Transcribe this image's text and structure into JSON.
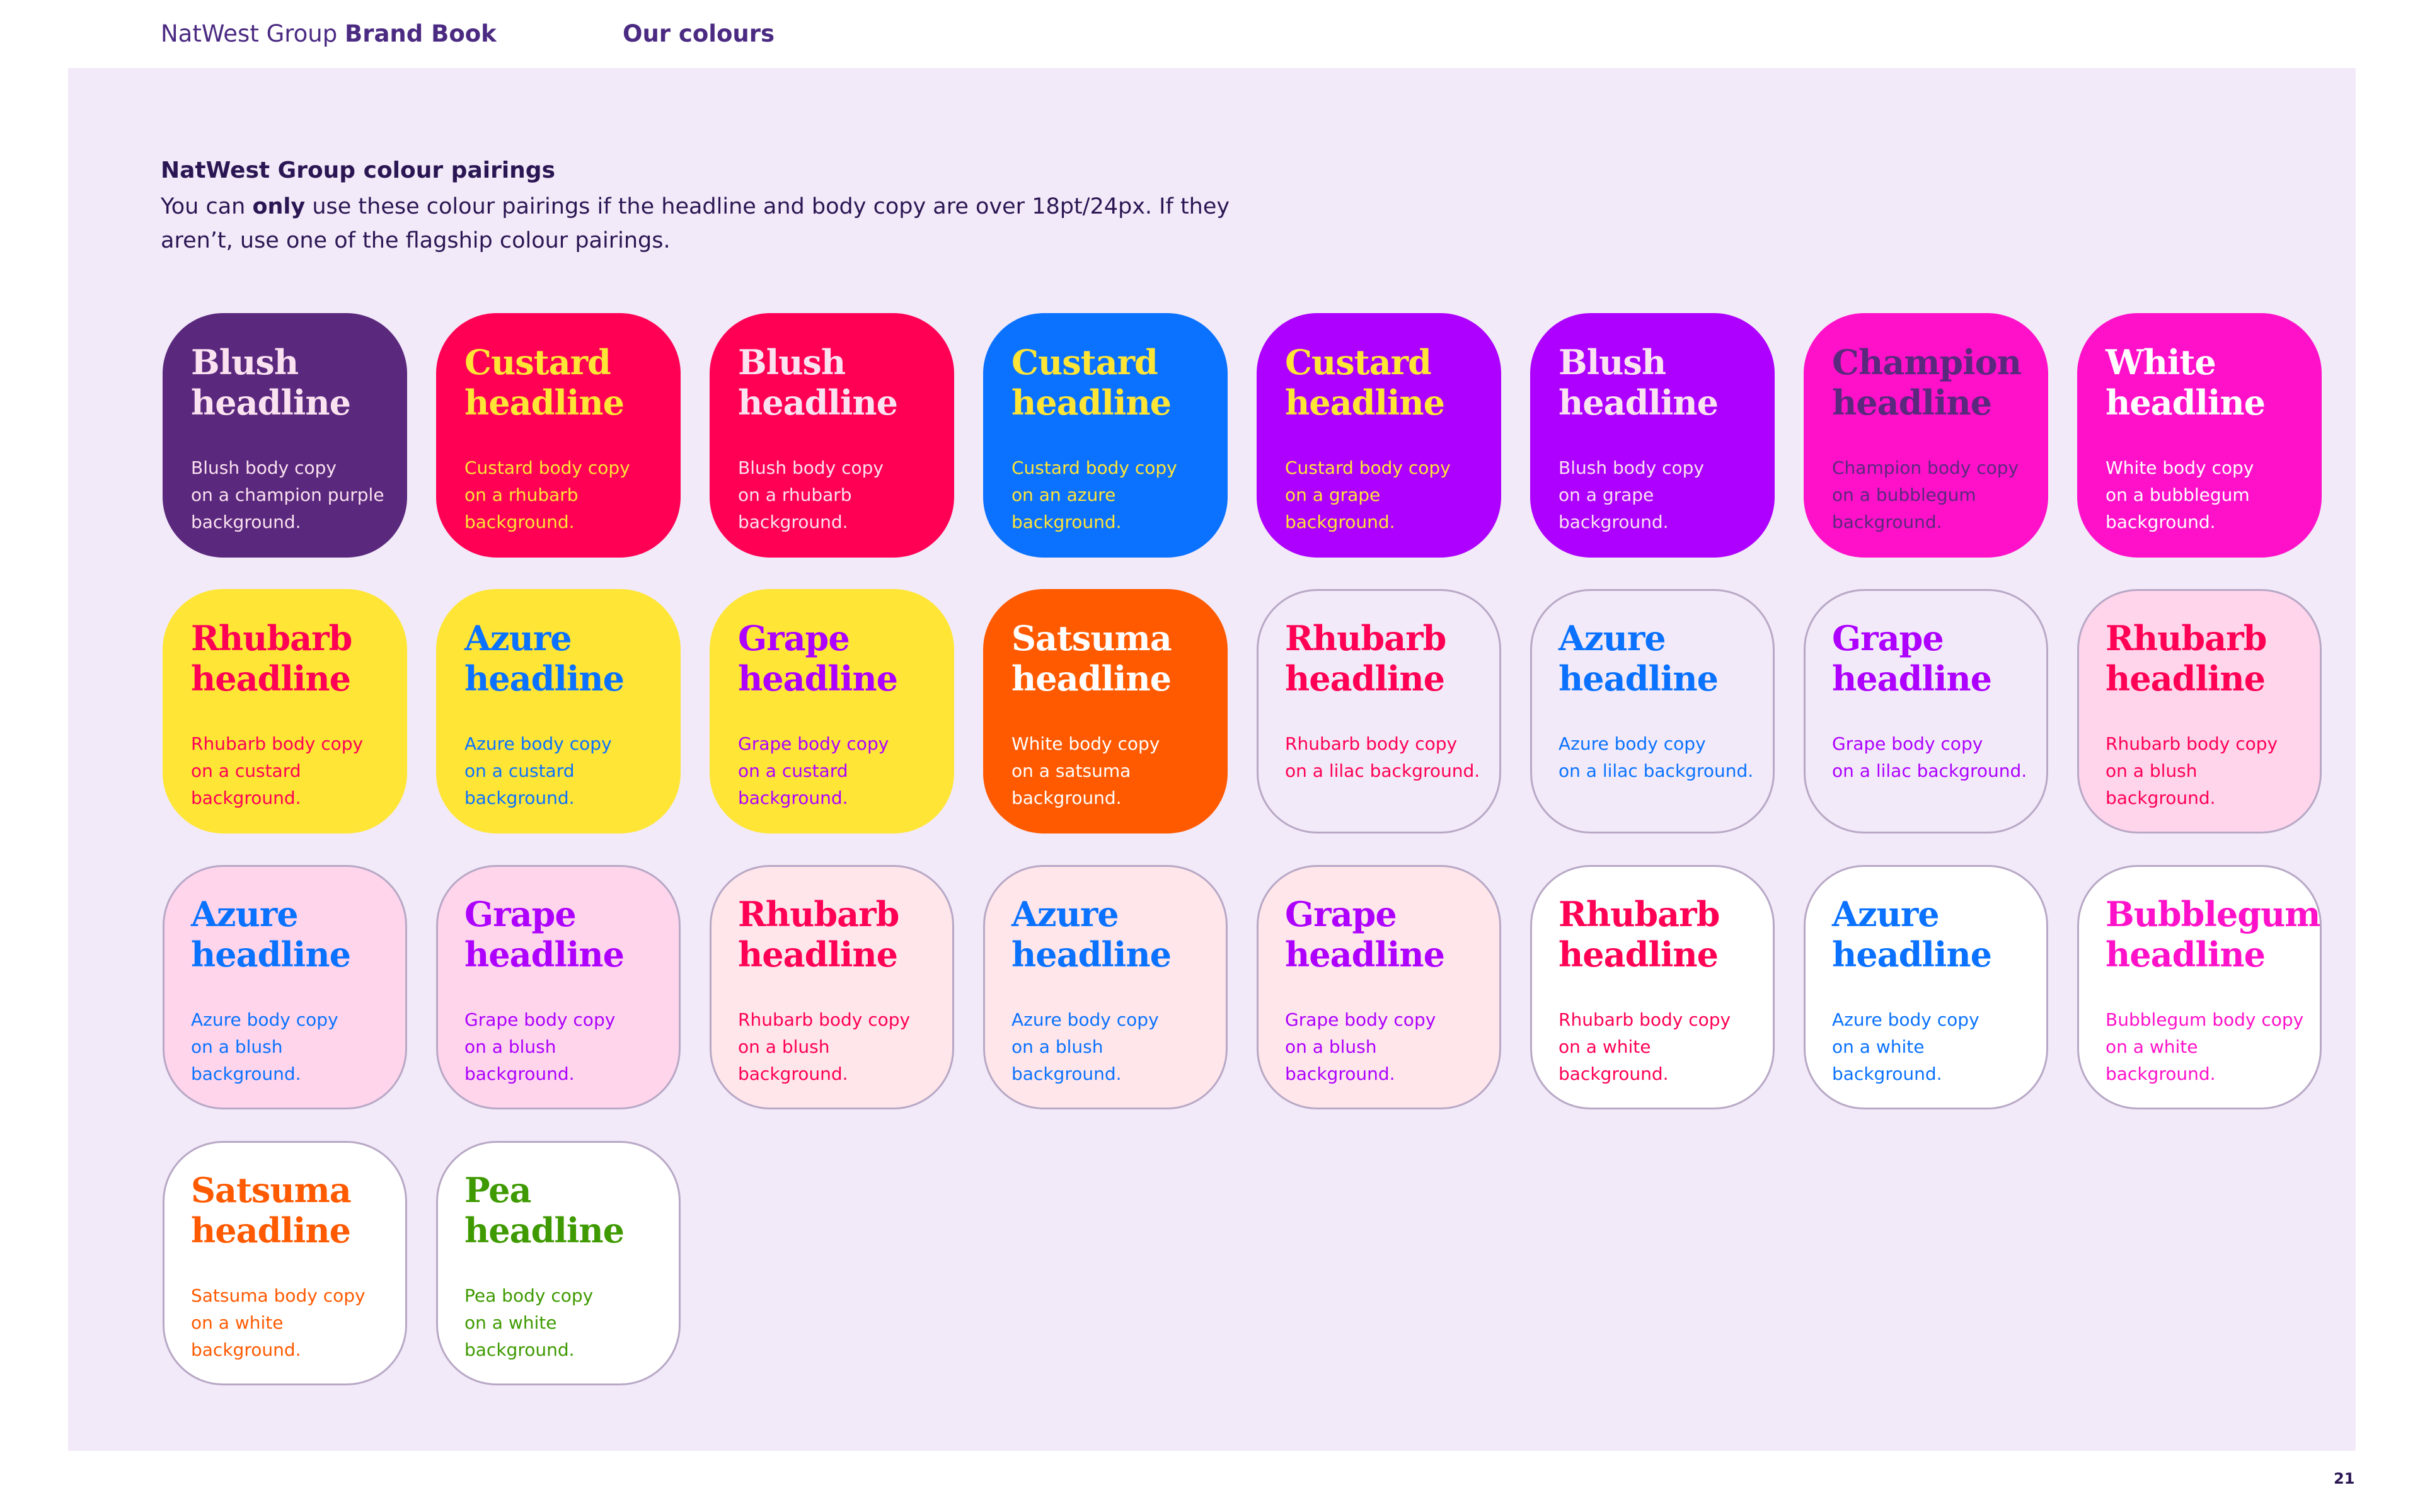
{
  "header": {
    "brand_regular": "NatWest Group ",
    "brand_bold": "Brand Book",
    "section": "Our colours"
  },
  "intro": {
    "title": "NatWest Group colour pairings",
    "body_before": "You can ",
    "body_bold": "only",
    "body_after": " use these colour pairings if the headline and body copy are over 18pt/24px. If they aren’t, use one of the flagship colour pairings."
  },
  "colors": {
    "champion_purple": "#5a287d",
    "rhubarb": "#ff0054",
    "azure": "#0a72ff",
    "grape": "#ad00ff",
    "bubblegum": "#ff11c9",
    "custard": "#ffe536",
    "satsuma": "#ff5a00",
    "blush": "#ffd5ec",
    "lilac": "#f2eaf8",
    "white": "#ffffff",
    "pea": "#3e9a00",
    "blush_light": "#ffe6ea"
  },
  "tiles": [
    {
      "headline_1": "Blush",
      "headline_2": "headline",
      "body_1": "Blush body copy",
      "body_2": "on a champion purple",
      "body_3": "background.",
      "bg": "#5a287d",
      "fg": "#fbe2f0",
      "outline": false
    },
    {
      "headline_1": "Custard",
      "headline_2": "headline",
      "body_1": "Custard body copy",
      "body_2": "on a rhubarb",
      "body_3": "background.",
      "bg": "#ff0054",
      "fg": "#ffe536",
      "outline": false
    },
    {
      "headline_1": "Blush",
      "headline_2": "headline",
      "body_1": "Blush body copy",
      "body_2": "on a rhubarb",
      "body_3": "background.",
      "bg": "#ff0054",
      "fg": "#fbe2f0",
      "outline": false
    },
    {
      "headline_1": "Custard",
      "headline_2": "headline",
      "body_1": "Custard body copy",
      "body_2": "on an azure",
      "body_3": "background.",
      "bg": "#0a72ff",
      "fg": "#ffe536",
      "outline": false
    },
    {
      "headline_1": "Custard",
      "headline_2": "headline",
      "body_1": "Custard body copy",
      "body_2": "on a grape background.",
      "body_3": "",
      "bg": "#ad00ff",
      "fg": "#ffe536",
      "outline": false
    },
    {
      "headline_1": "Blush",
      "headline_2": "headline",
      "body_1": "Blush body copy",
      "body_2": "on a grape background.",
      "body_3": "",
      "bg": "#ad00ff",
      "fg": "#fbe2f0",
      "outline": false
    },
    {
      "headline_1": "Champion",
      "headline_2": "headline",
      "body_1": "Champion body copy",
      "body_2": "on a bubblegum",
      "body_3": "background.",
      "bg": "#ff11c9",
      "fg": "#5a287d",
      "outline": false
    },
    {
      "headline_1": "White",
      "headline_2": "headline",
      "body_1": "White body copy",
      "body_2": "on a bubblegum",
      "body_3": "background.",
      "bg": "#ff11c9",
      "fg": "#ffffff",
      "outline": false
    },
    {
      "headline_1": "Rhubarb",
      "headline_2": "headline",
      "body_1": "Rhubarb body copy",
      "body_2": "on a custard",
      "body_3": "background.",
      "bg": "#ffe536",
      "fg": "#ff0054",
      "outline": false
    },
    {
      "headline_1": "Azure",
      "headline_2": "headline",
      "body_1": "Azure body copy",
      "body_2": "on a custard",
      "body_3": "background.",
      "bg": "#ffe536",
      "fg": "#0a72ff",
      "outline": false
    },
    {
      "headline_1": "Grape",
      "headline_2": "headline",
      "body_1": "Grape body copy",
      "body_2": "on a custard",
      "body_3": "background.",
      "bg": "#ffe536",
      "fg": "#ad00ff",
      "outline": false
    },
    {
      "headline_1": "Satsuma",
      "headline_2": "headline",
      "body_1": "White body copy",
      "body_2": "on a satsuma",
      "body_3": "background.",
      "bg": "#ff5a00",
      "fg": "#ffffff",
      "outline": false
    },
    {
      "headline_1": "Rhubarb",
      "headline_2": "headline",
      "body_1": "Rhubarb body copy",
      "body_2": "on a lilac background.",
      "body_3": "",
      "bg": "#f2eaf8",
      "fg": "#ff0054",
      "outline": true
    },
    {
      "headline_1": "Azure",
      "headline_2": "headline",
      "body_1": "Azure body copy",
      "body_2": "on a lilac background.",
      "body_3": "",
      "bg": "#f2eaf8",
      "fg": "#0a72ff",
      "outline": true
    },
    {
      "headline_1": "Grape",
      "headline_2": "headline",
      "body_1": "Grape body copy",
      "body_2": "on a lilac background.",
      "body_3": "",
      "bg": "#f2eaf8",
      "fg": "#ad00ff",
      "outline": true
    },
    {
      "headline_1": "Rhubarb",
      "headline_2": "headline",
      "body_1": "Rhubarb body copy",
      "body_2": "on a blush background.",
      "body_3": "",
      "bg": "#ffd5ec",
      "fg": "#ff0054",
      "outline": true
    },
    {
      "headline_1": "Azure",
      "headline_2": "headline",
      "body_1": "Azure body copy",
      "body_2": "on a blush background.",
      "body_3": "",
      "bg": "#ffd5ec",
      "fg": "#0a72ff",
      "outline": true
    },
    {
      "headline_1": "Grape",
      "headline_2": "headline",
      "body_1": "Grape body copy",
      "body_2": "on a blush background.",
      "body_3": "",
      "bg": "#ffd5ec",
      "fg": "#ad00ff",
      "outline": true
    },
    {
      "headline_1": "Rhubarb",
      "headline_2": "headline",
      "body_1": "Rhubarb body copy",
      "body_2": "on a blush background.",
      "body_3": "",
      "bg": "#ffe6ea",
      "fg": "#ff0054",
      "outline": true
    },
    {
      "headline_1": "Azure",
      "headline_2": "headline",
      "body_1": "Azure body copy",
      "body_2": "on a blush background.",
      "body_3": "",
      "bg": "#ffe6ea",
      "fg": "#0a72ff",
      "outline": true
    },
    {
      "headline_1": "Grape",
      "headline_2": "headline",
      "body_1": "Grape body copy",
      "body_2": "on a blush background.",
      "body_3": "",
      "bg": "#ffe6ea",
      "fg": "#ad00ff",
      "outline": true
    },
    {
      "headline_1": "Rhubarb",
      "headline_2": "headline",
      "body_1": "Rhubarb body copy",
      "body_2": "on a white background.",
      "body_3": "",
      "bg": "#ffffff",
      "fg": "#ff0054",
      "outline": true
    },
    {
      "headline_1": "Azure",
      "headline_2": "headline",
      "body_1": "Azure body copy",
      "body_2": "on a white background.",
      "body_3": "",
      "bg": "#ffffff",
      "fg": "#0a72ff",
      "outline": true
    },
    {
      "headline_1": "Bubblegum",
      "headline_2": "headline",
      "body_1": "Bubblegum body copy",
      "body_2": "on a white background.",
      "body_3": "",
      "bg": "#ffffff",
      "fg": "#ff11c9",
      "outline": true
    },
    {
      "headline_1": "Satsuma",
      "headline_2": "headline",
      "body_1": "Satsuma body copy",
      "body_2": "on a white background.",
      "body_3": "",
      "bg": "#ffffff",
      "fg": "#ff5a00",
      "outline": true
    },
    {
      "headline_1": "Pea",
      "headline_2": "headline",
      "body_1": "Pea body copy",
      "body_2": "on a white background.",
      "body_3": "",
      "bg": "#ffffff",
      "fg": "#3e9a00",
      "outline": true
    }
  ],
  "page_number": "21"
}
